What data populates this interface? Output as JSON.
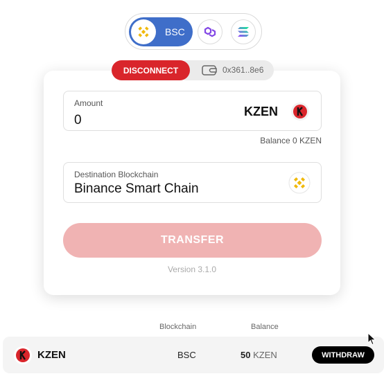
{
  "chain_switch": {
    "active_label": "BSC",
    "options": [
      {
        "name": "BSC",
        "icon": "bnb-icon"
      },
      {
        "name": "Polygon",
        "icon": "polygon-icon"
      },
      {
        "name": "Solana",
        "icon": "solana-icon"
      }
    ],
    "active_color": "#3f6ec9"
  },
  "wallet": {
    "disconnect_label": "DISCONNECT",
    "address": "0x361..8e6",
    "disconnect_color": "#d9252b"
  },
  "form": {
    "amount": {
      "label": "Amount",
      "value": "0",
      "token": "KZEN"
    },
    "balance_label": "Balance 0 KZEN",
    "destination": {
      "label": "Destination Blockchain",
      "value": "Binance Smart Chain"
    },
    "transfer_label": "TRANSFER",
    "version": "Version 3.1.0"
  },
  "table": {
    "headers": {
      "blockchain": "Blockchain",
      "balance": "Balance"
    },
    "rows": [
      {
        "token": "KZEN",
        "blockchain": "BSC",
        "balance_value": "50",
        "balance_unit": "KZEN",
        "action": "WITHDRAW"
      }
    ]
  }
}
